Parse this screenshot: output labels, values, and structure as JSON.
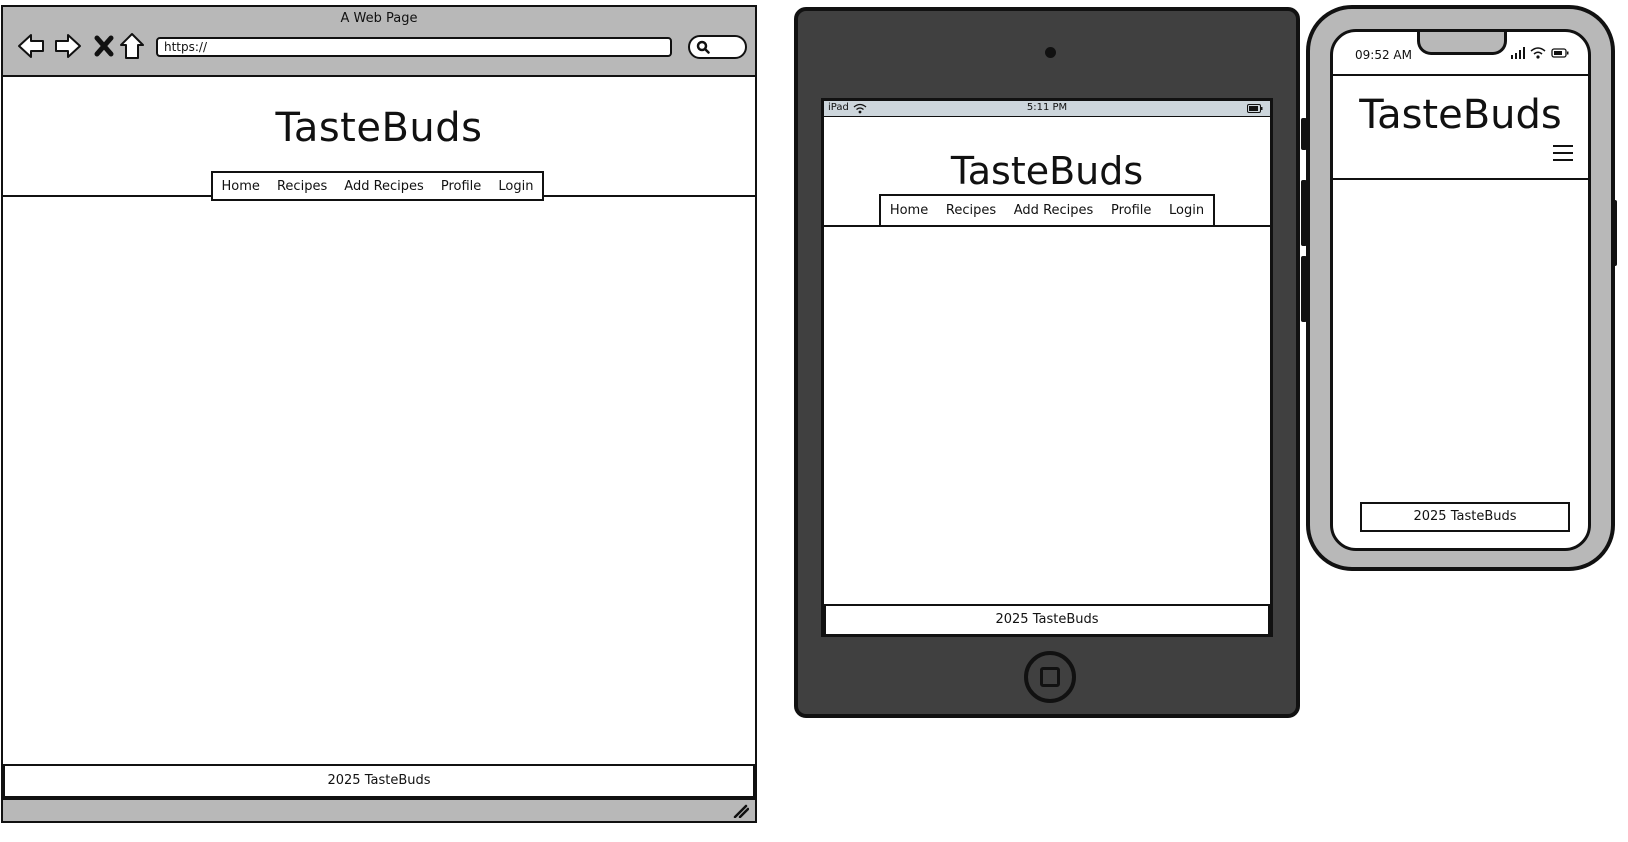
{
  "desktop": {
    "window_title": "A Web Page",
    "url": "https://",
    "brand": "TasteBuds",
    "nav": [
      "Home",
      "Recipes",
      "Add Recipes",
      "Profile",
      "Login"
    ],
    "footer": "2025 TasteBuds"
  },
  "tablet": {
    "status_device": "iPad",
    "status_time": "5:11 PM",
    "brand": "TasteBuds",
    "nav": [
      "Home",
      "Recipes",
      "Add Recipes",
      "Profile",
      "Login"
    ],
    "footer": "2025 TasteBuds"
  },
  "phone": {
    "status_time": "09:52 AM",
    "brand": "TasteBuds",
    "footer": "2025 TasteBuds"
  },
  "colors": {
    "frame_gray": "#b8b8b8",
    "tablet_body": "#404040",
    "status_bar": "#cdd6dc"
  },
  "icons": [
    "back-arrow-icon",
    "forward-arrow-icon",
    "stop-icon",
    "home-icon",
    "search-icon",
    "wifi-icon",
    "battery-icon",
    "signal-icon",
    "hamburger-menu-icon",
    "resize-grip-icon"
  ]
}
